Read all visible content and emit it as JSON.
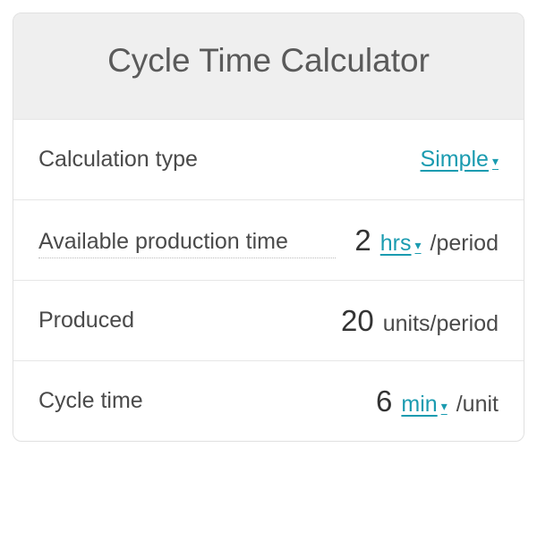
{
  "header": {
    "title": "Cycle Time Calculator"
  },
  "rows": {
    "calc_type": {
      "label": "Calculation type",
      "value_select": "Simple"
    },
    "prod_time": {
      "label": "Available production time",
      "value": "2",
      "unit_select": "hrs",
      "suffix": "/period"
    },
    "produced": {
      "label": "Produced",
      "value": "20",
      "unit": "units/period"
    },
    "cycle": {
      "label": "Cycle time",
      "value": "6",
      "unit_select": "min",
      "suffix": "/unit"
    }
  },
  "icons": {
    "chevron": "▾"
  }
}
